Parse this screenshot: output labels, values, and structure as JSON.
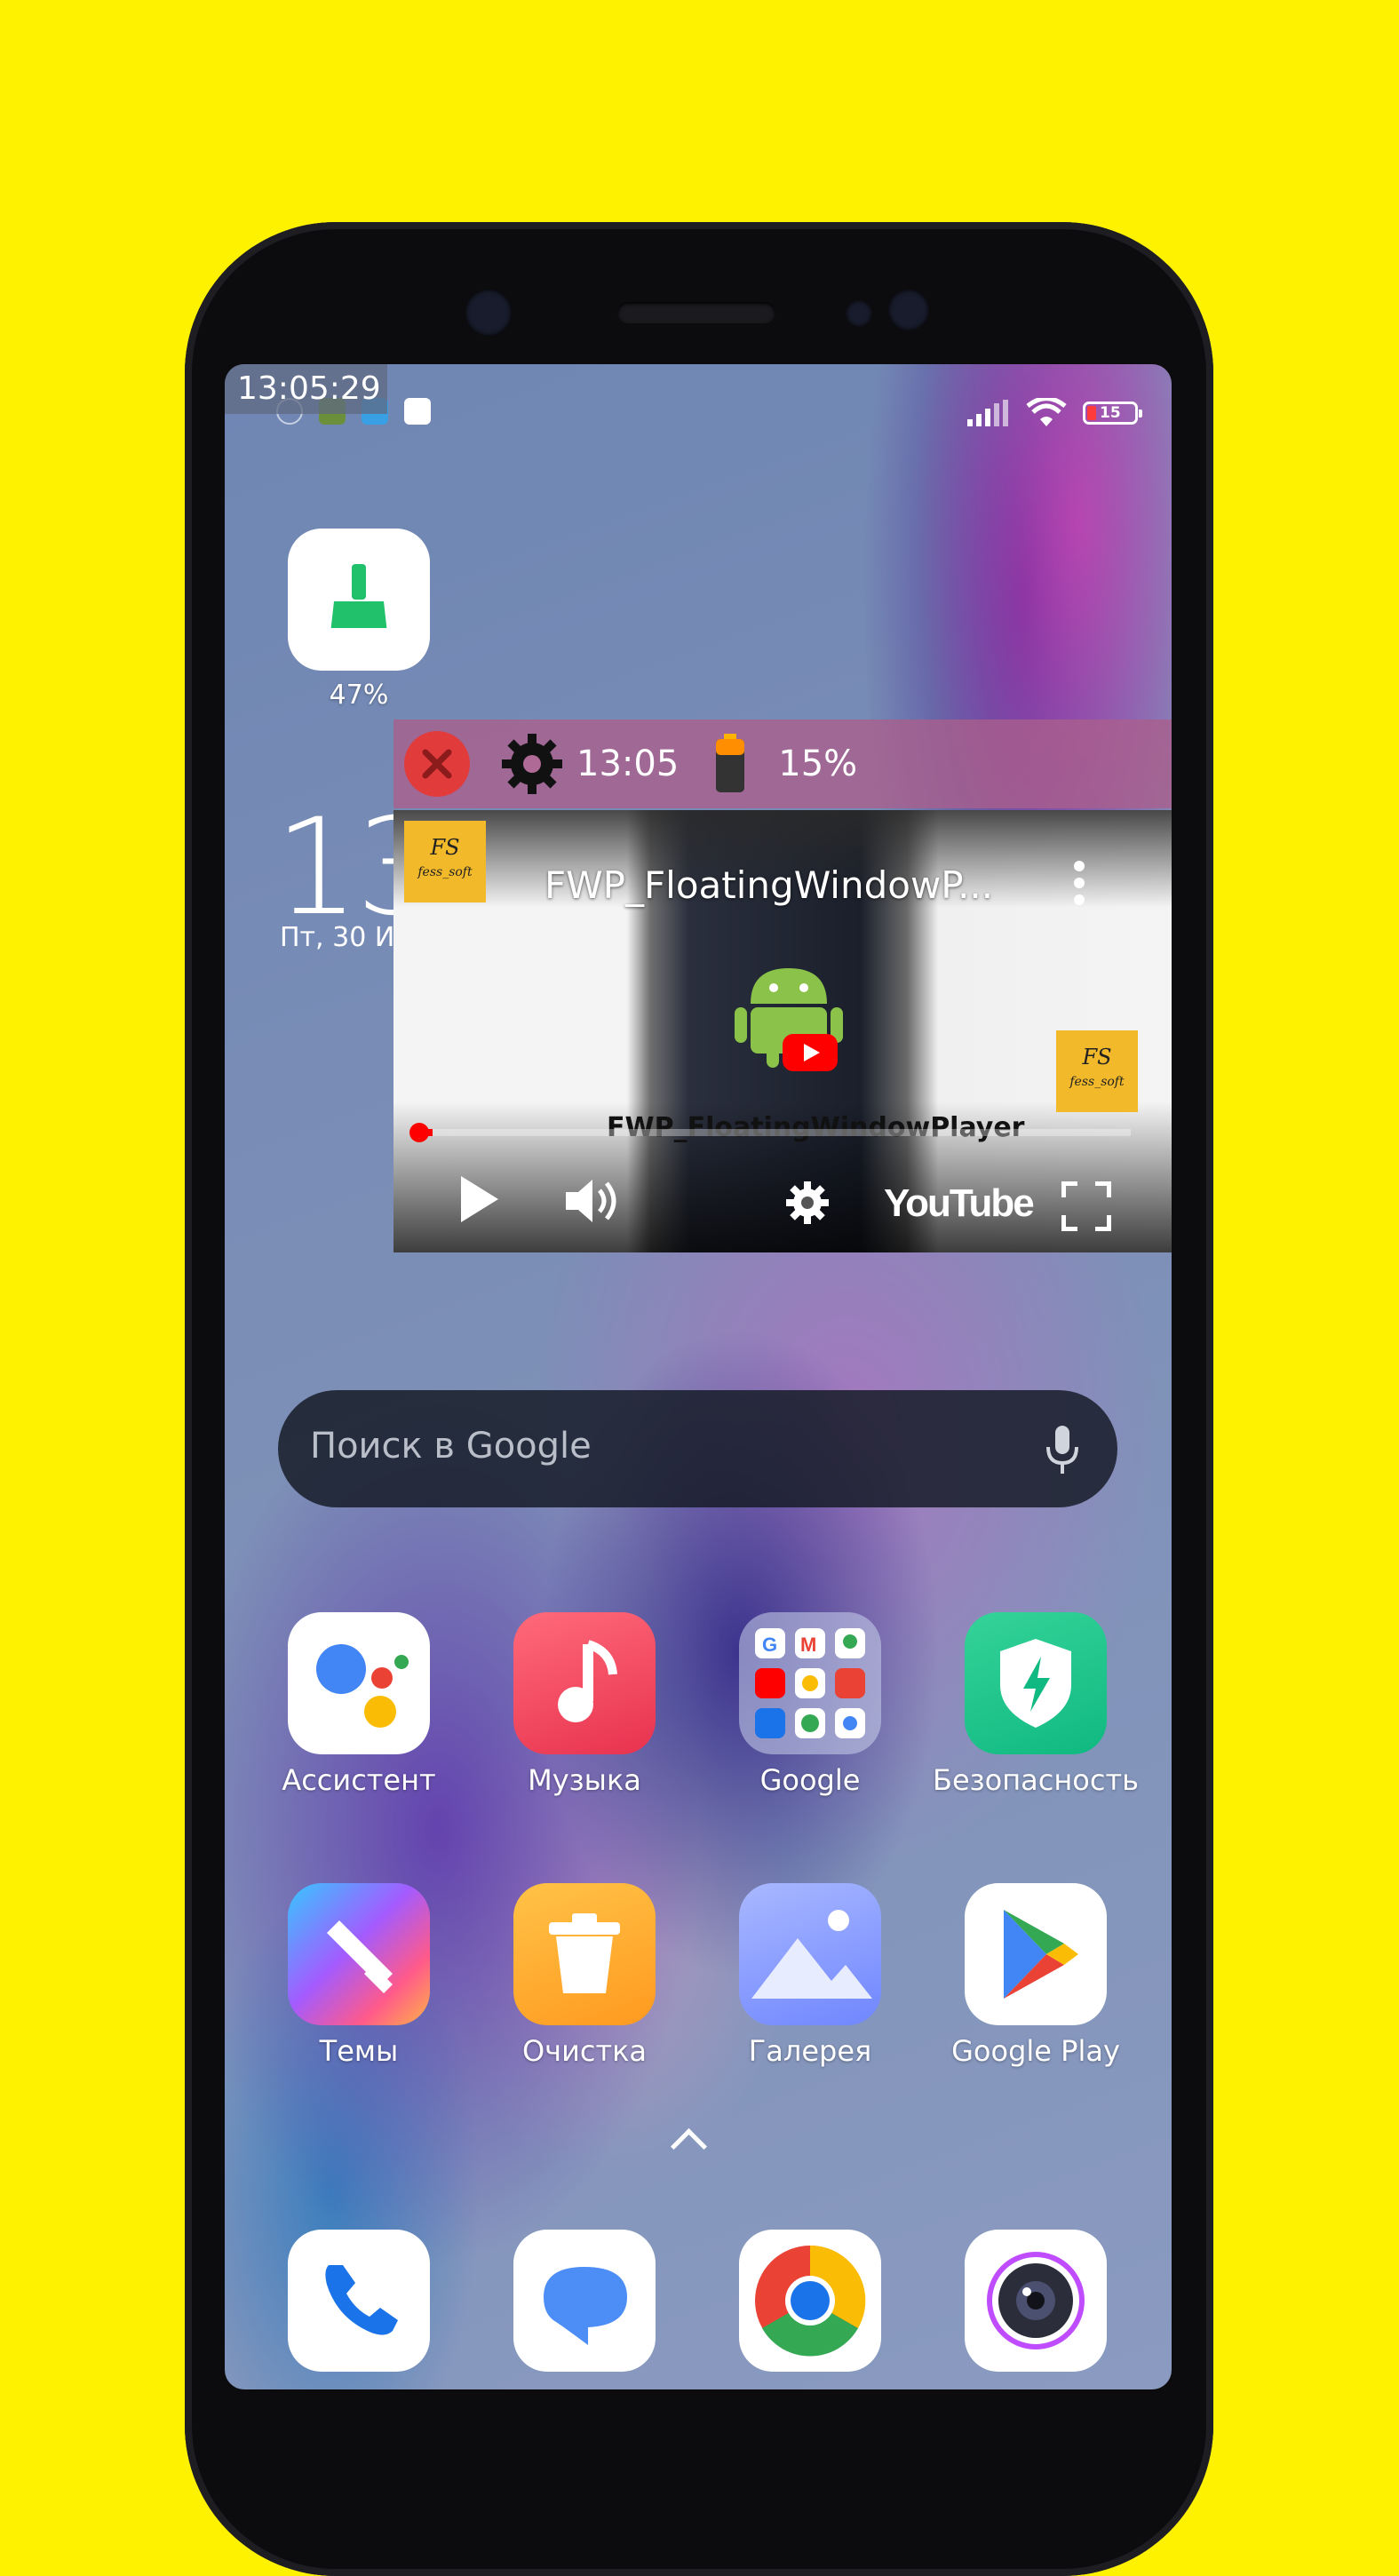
{
  "status_bar": {
    "time_overlay": "13:05:29",
    "battery": "15"
  },
  "widgets": {
    "cleaner": {
      "percent": "47%"
    }
  },
  "home_clock": {
    "time": "13:",
    "date": "Пт, 30 Ин"
  },
  "floating_window": {
    "toolbar": {
      "time": "13:05",
      "battery": "15%"
    },
    "video": {
      "title": "FWP_FloatingWindowP...",
      "caption": "FWP_FloatingWindowPlayer",
      "logo_top": "FS",
      "logo_bottom": "fess_soft",
      "brand": "YouTube",
      "progress": 0.02
    }
  },
  "search": {
    "placeholder": "Поиск в Google"
  },
  "apps_row1": [
    {
      "label": "Ассистент"
    },
    {
      "label": "Музыка"
    },
    {
      "label": "Google"
    },
    {
      "label": "Безопасность"
    }
  ],
  "apps_row2": [
    {
      "label": "Темы"
    },
    {
      "label": "Очистка"
    },
    {
      "label": "Галерея"
    },
    {
      "label": "Google Play"
    }
  ],
  "dock": [
    {
      "icon": "phone-icon"
    },
    {
      "icon": "messages-icon"
    },
    {
      "icon": "chrome-icon"
    },
    {
      "icon": "camera-icon"
    }
  ],
  "colors": {
    "background": "#fff200",
    "close_red": "#e23b3b",
    "youtube_red": "#ff0000"
  }
}
